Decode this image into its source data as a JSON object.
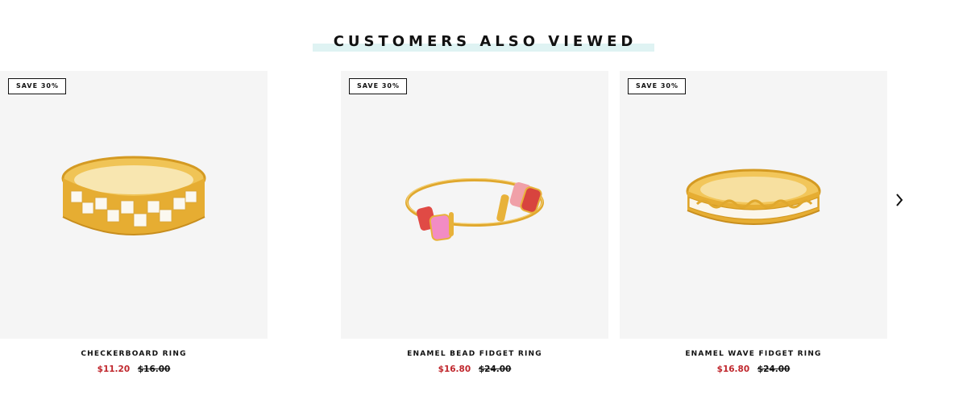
{
  "section": {
    "title": "CUSTOMERS ALSO VIEWED"
  },
  "products": [
    {
      "badge": "SAVE 30%",
      "name": "ENAMEL BEAD FIDGET RING",
      "sale_price": "$16.80",
      "original_price": "$24.00",
      "image_icon": "enamel-bead-ring"
    },
    {
      "badge": "SAVE 30%",
      "name": "ENAMEL WAVE FIDGET RING",
      "sale_price": "$16.80",
      "original_price": "$24.00",
      "image_icon": "enamel-wave-ring"
    },
    {
      "badge": "SAVE 30%",
      "name": "CHECKERBOARD RING",
      "sale_price": "$11.20",
      "original_price": "$16.00",
      "image_icon": "checkerboard-ring"
    }
  ],
  "colors": {
    "sale": "#c0272d",
    "title_highlight": "#dff3f3",
    "card_bg": "#f5f5f5",
    "gold": "#e0a82e"
  },
  "nav": {
    "prev_icon": "chevron-left-icon",
    "next_icon": "chevron-right-icon"
  }
}
